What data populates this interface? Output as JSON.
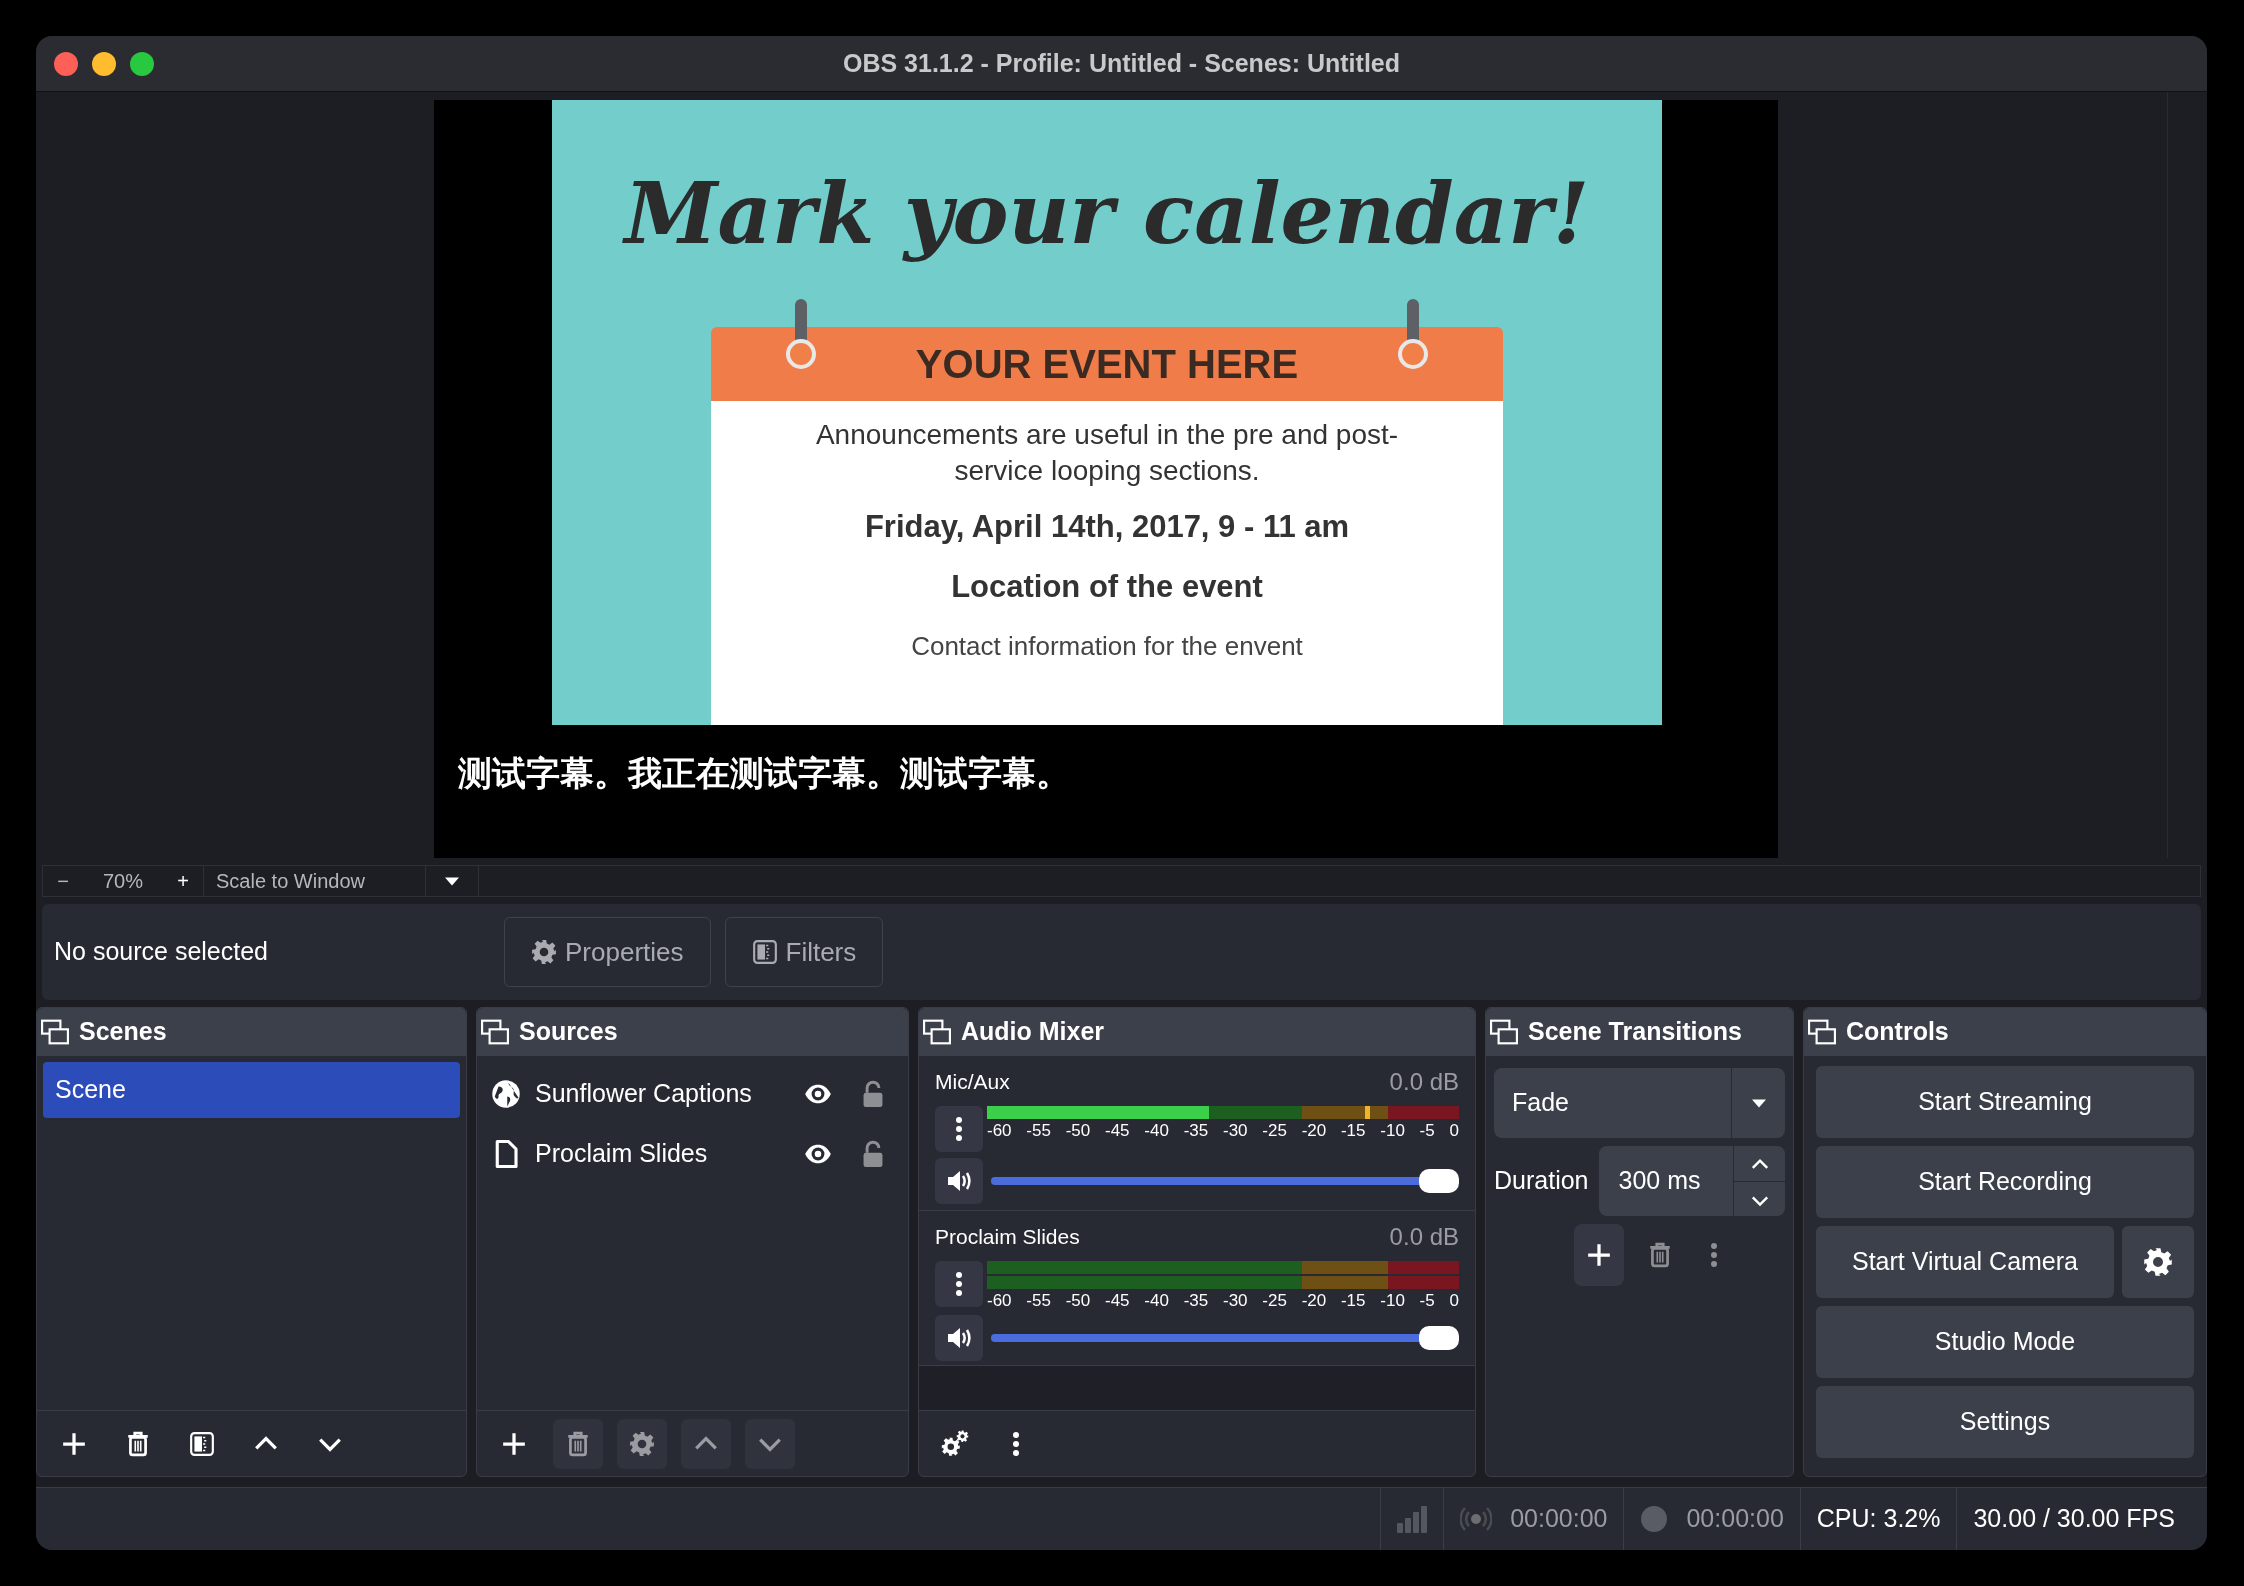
{
  "window": {
    "title": "OBS 31.1.2 - Profile: Untitled - Scenes: Untitled"
  },
  "preview": {
    "slide": {
      "heading": "Mark your calendar!",
      "banner": "YOUR EVENT HERE",
      "lines": [
        {
          "kind": "body",
          "text": "Announcements are useful in the pre and post-service looping sections."
        },
        {
          "kind": "bold",
          "text": "Friday, April 14th, 2017, 9 - 11 am"
        },
        {
          "kind": "bold",
          "text": "Location of the event"
        },
        {
          "kind": "small",
          "text": "Contact information for the envent"
        }
      ]
    },
    "caption": "测试字幕。我正在测试字幕。测试字幕。"
  },
  "zoom_bar": {
    "minus": "−",
    "zoom": "70%",
    "plus": "+",
    "scale_mode": "Scale to Window"
  },
  "source_bar": {
    "status": "No source selected",
    "buttons": [
      {
        "kind": "properties",
        "label": "Properties"
      },
      {
        "kind": "filters",
        "label": "Filters"
      }
    ]
  },
  "scenes": {
    "title": "Scenes",
    "items": [
      {
        "label": "Scene",
        "selected": true
      }
    ]
  },
  "sources": {
    "title": "Sources",
    "items": [
      {
        "label": "Sunflower Captions",
        "kind": "browser",
        "visible": true,
        "locked": false
      },
      {
        "label": "Proclaim Slides",
        "kind": "file",
        "visible": true,
        "locked": false
      }
    ]
  },
  "audio_mixer": {
    "title": "Audio Mixer",
    "channels": [
      {
        "name": "Mic/Aux",
        "reading": "0.0 dB",
        "meters": [
          {
            "level": 0.47,
            "peak": {
              "level": 0.8
            }
          }
        ],
        "scale": [
          "-60",
          "-55",
          "-50",
          "-45",
          "-40",
          "-35",
          "-30",
          "-25",
          "-20",
          "-15",
          "-10",
          "-5",
          "0"
        ],
        "volume": {
          "level": 1
        }
      },
      {
        "name": "Proclaim Slides",
        "reading": "0.0 dB",
        "meters": [
          {
            "level": 0
          },
          {
            "level": 0
          }
        ],
        "scale": [
          "-60",
          "-55",
          "-50",
          "-45",
          "-40",
          "-35",
          "-30",
          "-25",
          "-20",
          "-15",
          "-10",
          "-5",
          "0"
        ],
        "volume": {
          "level": 1
        }
      }
    ]
  },
  "transitions": {
    "title": "Scene Transitions",
    "transition": "Fade",
    "duration_label": "Duration",
    "duration": "300 ms"
  },
  "controls": {
    "title": "Controls",
    "buttons": [
      {
        "label": "Start Streaming",
        "kind": "plain"
      },
      {
        "label": "Start Recording",
        "kind": "plain"
      },
      {
        "label": "Start Virtual Camera",
        "kind": "with_settings"
      },
      {
        "label": "Studio Mode",
        "kind": "plain"
      },
      {
        "label": "Settings",
        "kind": "plain"
      }
    ]
  },
  "status_bar": {
    "stream_time": "00:00:00",
    "record_time": "00:00:00",
    "cpu": "CPU: 3.2%",
    "fps": "30.00 / 30.00 FPS"
  }
}
